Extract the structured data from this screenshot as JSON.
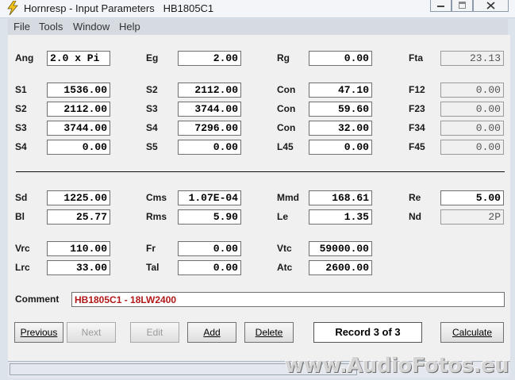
{
  "window": {
    "title": "Hornresp - Input Parameters   HB1805C1"
  },
  "menu": [
    "File",
    "Tools",
    "Window",
    "Help"
  ],
  "fields": {
    "ang": {
      "label": "Ang",
      "value": "2.0 x Pi"
    },
    "eg": {
      "label": "Eg",
      "value": "2.00"
    },
    "rg": {
      "label": "Rg",
      "value": "0.00"
    },
    "fta": {
      "label": "Fta",
      "value": "23.13"
    },
    "s1": {
      "label": "S1",
      "value": "1536.00"
    },
    "s2a": {
      "label": "S2",
      "value": "2112.00"
    },
    "con1": {
      "label": "Con",
      "value": "47.10"
    },
    "f12": {
      "label": "F12",
      "value": "0.00"
    },
    "s2b": {
      "label": "S2",
      "value": "2112.00"
    },
    "s3a": {
      "label": "S3",
      "value": "3744.00"
    },
    "con2": {
      "label": "Con",
      "value": "59.60"
    },
    "f23": {
      "label": "F23",
      "value": "0.00"
    },
    "s3b": {
      "label": "S3",
      "value": "3744.00"
    },
    "s4a": {
      "label": "S4",
      "value": "7296.00"
    },
    "con3": {
      "label": "Con",
      "value": "32.00"
    },
    "f34": {
      "label": "F34",
      "value": "0.00"
    },
    "s4b": {
      "label": "S4",
      "value": "0.00"
    },
    "s5": {
      "label": "S5",
      "value": "0.00"
    },
    "l45": {
      "label": "L45",
      "value": "0.00"
    },
    "f45": {
      "label": "F45",
      "value": "0.00"
    },
    "sd": {
      "label": "Sd",
      "value": "1225.00"
    },
    "cms": {
      "label": "Cms",
      "value": "1.07E-04"
    },
    "mmd": {
      "label": "Mmd",
      "value": "168.61"
    },
    "re": {
      "label": "Re",
      "value": "5.00"
    },
    "bl": {
      "label": "Bl",
      "value": "25.77"
    },
    "rms": {
      "label": "Rms",
      "value": "5.90"
    },
    "le": {
      "label": "Le",
      "value": "1.35"
    },
    "nd": {
      "label": "Nd",
      "value": "2P"
    },
    "vrc": {
      "label": "Vrc",
      "value": "110.00"
    },
    "fr": {
      "label": "Fr",
      "value": "0.00"
    },
    "vtc": {
      "label": "Vtc",
      "value": "59000.00"
    },
    "lrc": {
      "label": "Lrc",
      "value": "33.00"
    },
    "tal": {
      "label": "Tal",
      "value": "0.00"
    },
    "atc": {
      "label": "Atc",
      "value": "2600.00"
    }
  },
  "comment": {
    "label": "Comment",
    "value": "HB1805C1 - 18LW2400"
  },
  "buttons": {
    "previous": "Previous",
    "next": "Next",
    "edit": "Edit",
    "add": "Add",
    "delete": "Delete",
    "calculate": "Calculate"
  },
  "record": "Record 3 of 3",
  "watermark": "www.AudioFotos.eu"
}
